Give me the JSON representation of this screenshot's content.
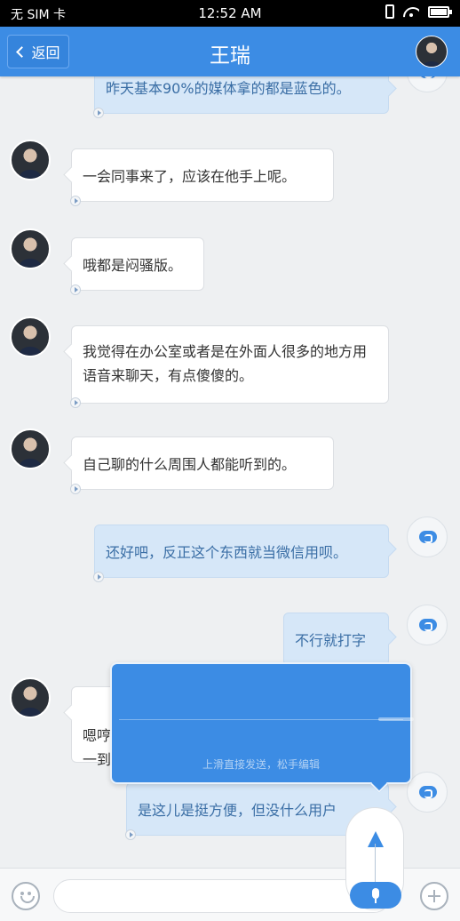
{
  "status_bar": {
    "carrier": "无 SIM 卡",
    "time": "12:52 AM",
    "icons": [
      "vibrate-icon",
      "wifi-icon",
      "battery-icon"
    ]
  },
  "header": {
    "back_label": "返回",
    "title": "王瑞",
    "accent_color": "#3c8ce4"
  },
  "messages": [
    {
      "side": "right",
      "text": "昨天基本90%的媒体拿的都是蓝色的。"
    },
    {
      "side": "left",
      "text": "一会同事来了，应该在他手上呢。"
    },
    {
      "side": "left",
      "text": "哦都是闷骚版。"
    },
    {
      "side": "left",
      "text": "我觉得在办公室或者是在外面人很多的地方用语音来聊天，有点傻傻的。"
    },
    {
      "side": "left",
      "text": "自己聊的什么周围人都能听到的。"
    },
    {
      "side": "right",
      "text": "还好吧，反正这个东西就当微信用呗。"
    },
    {
      "side": "right",
      "text": "不行就打字"
    },
    {
      "side": "left",
      "text": "嗯哼\n一到"
    },
    {
      "side": "right",
      "text": "是这儿是挺方便，但没什么用户"
    }
  ],
  "recording": {
    "hint": "上滑直接发送，松手编辑"
  },
  "input_bar": {
    "placeholder": ""
  }
}
